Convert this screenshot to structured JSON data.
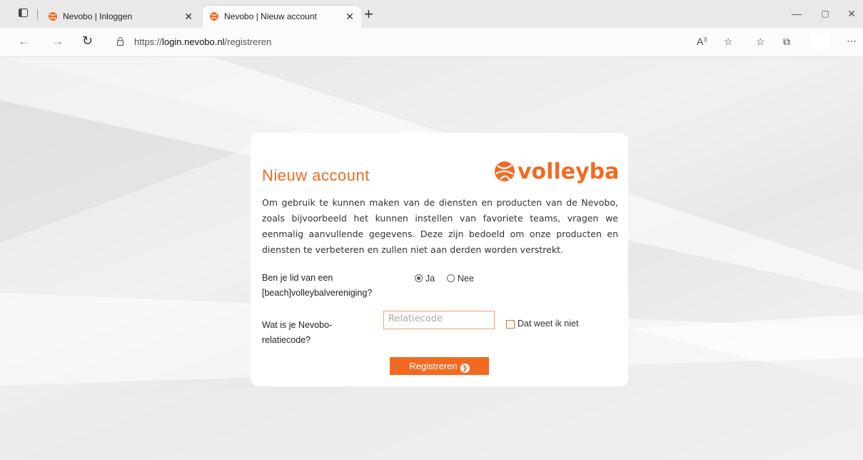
{
  "browser": {
    "tabs": [
      {
        "title": "Nevobo | Inloggen",
        "active": false
      },
      {
        "title": "Nevobo | Nieuw account",
        "active": true
      }
    ],
    "url_prefix": "https://",
    "url_domain": "login.nevobo.nl",
    "url_path": "/registreren",
    "new_tab": "+"
  },
  "form": {
    "title": "Nieuw account",
    "logo_text": "volleybal",
    "intro": "Om gebruik te kunnen maken van de diensten en producten van de Nevobo, zoals bijvoorbeeld het kunnen instellen van favoriete teams, vragen we eenmalig aanvullende gegevens. Deze zijn bedoeld om onze producten en diensten te verbeteren en zullen niet aan derden worden verstrekt.",
    "member_question": "Ben je lid van een [beach]volleybalvereniging?",
    "option_yes": "Ja",
    "option_no": "Nee",
    "selected": "Ja",
    "code_question": "Wat is je Nevobo-relatiecode?",
    "code_placeholder": "Relatiecode",
    "code_value": "",
    "dont_know_label": "Dat weet ik niet",
    "submit_label": "Registreren"
  },
  "colors": {
    "accent": "#f26a22"
  }
}
